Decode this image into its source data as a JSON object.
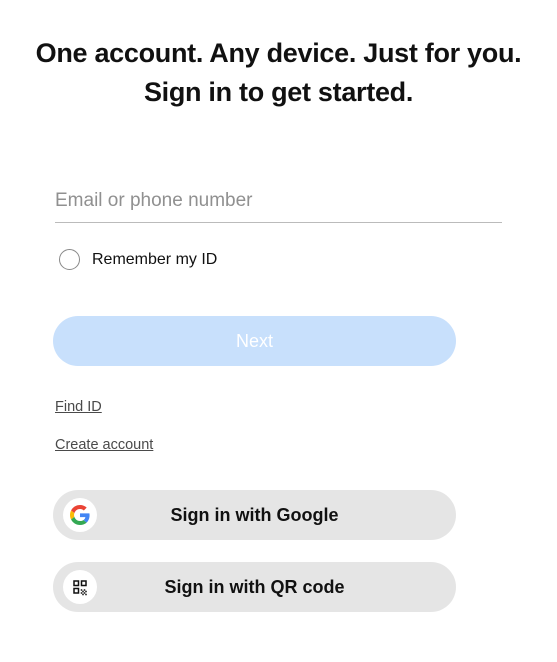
{
  "heading": "One account. Any device. Just for you. Sign in to get started.",
  "form": {
    "email": {
      "placeholder": "Email or phone number",
      "value": ""
    },
    "remember": {
      "label": "Remember my ID",
      "checked": false
    },
    "next_button": "Next"
  },
  "links": {
    "find_id": "Find ID",
    "create_account": "Create account"
  },
  "oauth": {
    "google": {
      "label": "Sign in with Google",
      "icon": "google-logo"
    },
    "qr": {
      "label": "Sign in with QR code",
      "icon": "qr-code-icon"
    }
  }
}
